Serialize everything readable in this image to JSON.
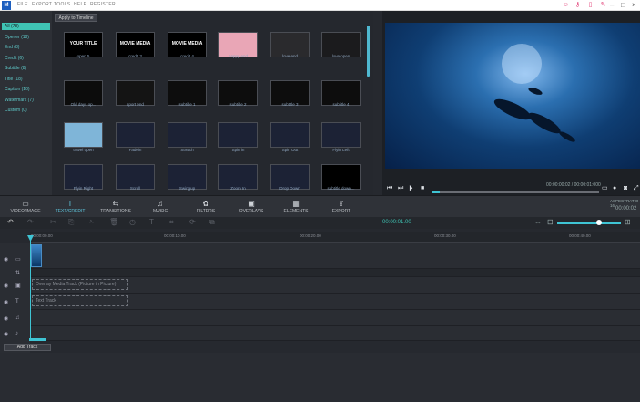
{
  "menubar": {
    "items": [
      "FILE",
      "EXPORT",
      "TOOLS",
      "HELP",
      "REGISTER"
    ]
  },
  "library": {
    "apply_label": "Apply to Timeline",
    "categories": [
      "All (78)",
      "Opener (18)",
      "End (8)",
      "Credit (6)",
      "Subtitle (8)",
      "Title (18)",
      "Caption (10)",
      "Watermark (7)",
      "Custom (0)"
    ],
    "tiles": [
      {
        "label": "open 5",
        "text": "YOUR TITLE",
        "bg": "#000"
      },
      {
        "label": "credit 3",
        "text": "MOVIE MEDIA",
        "bg": "#000"
      },
      {
        "label": "credit 4",
        "text": "MOVIE MEDIA",
        "bg": "#000"
      },
      {
        "label": "happy end",
        "text": "",
        "bg": "#e9a6b6"
      },
      {
        "label": "love end",
        "text": "",
        "bg": "#2a2a2d"
      },
      {
        "label": "love open",
        "text": "",
        "bg": "#1b1b1d"
      },
      {
        "label": "Old days op...",
        "text": "",
        "bg": "#0c0c0c"
      },
      {
        "label": "sport end",
        "text": "",
        "bg": "#141414"
      },
      {
        "label": "subtitle 1",
        "text": "",
        "bg": "#0d0d0d"
      },
      {
        "label": "subtitle 2",
        "text": "",
        "bg": "#0d0d0d"
      },
      {
        "label": "subtitle 3",
        "text": "",
        "bg": "#0d0d0d"
      },
      {
        "label": "subtitle 4",
        "text": "",
        "bg": "#0d0d0d"
      },
      {
        "label": "travel open",
        "text": "",
        "bg": "#7fb5d8"
      },
      {
        "label": "Fadein",
        "text": "",
        "bg": "#1c2235"
      },
      {
        "label": "Stretch",
        "text": "",
        "bg": "#1c2235"
      },
      {
        "label": "Spin in",
        "text": "",
        "bg": "#1c2235"
      },
      {
        "label": "Spin Out",
        "text": "",
        "bg": "#1c2235"
      },
      {
        "label": "Flyin Left",
        "text": "",
        "bg": "#1c2235"
      },
      {
        "label": "Flyin Right",
        "text": "",
        "bg": "#1c2235"
      },
      {
        "label": "Scroll",
        "text": "",
        "bg": "#1c2235"
      },
      {
        "label": "Swingup",
        "text": "",
        "bg": "#1c2235"
      },
      {
        "label": "Zoom In",
        "text": "",
        "bg": "#1c2235"
      },
      {
        "label": "Drop Down",
        "text": "",
        "bg": "#1c2235"
      },
      {
        "label": "subtitle down...",
        "text": "",
        "bg": "#000"
      }
    ]
  },
  "preview": {
    "timecode": "00:00:00:02 / 00:00:01:000",
    "progress": 0.05
  },
  "toolbar": {
    "tabs": [
      "VIDEO/IMAGE",
      "TEXT/CREDIT",
      "TRANSITIONS",
      "MUSIC",
      "FILTERS",
      "OVERLAYS",
      "ELEMENTS",
      "EXPORT"
    ],
    "icons": [
      "▭",
      "T",
      "⇆",
      "♫",
      "✿",
      "▣",
      "▦",
      "⇪"
    ],
    "selected": 1,
    "aspect_label": "ASPECTRATIO 16",
    "right_time": "00:00:02"
  },
  "timeline": {
    "timecode": "00:00:01.00",
    "ruler": [
      "00:00:00.00",
      "00:00:10.00",
      "00:00:20.00",
      "00:00:30.00",
      "00:00:40.00"
    ],
    "overlay_track": "Overlay Media Track (Picture in Picture)",
    "text_track": "Text Track",
    "add_track": "Add Track",
    "zoom": 0.65
  }
}
